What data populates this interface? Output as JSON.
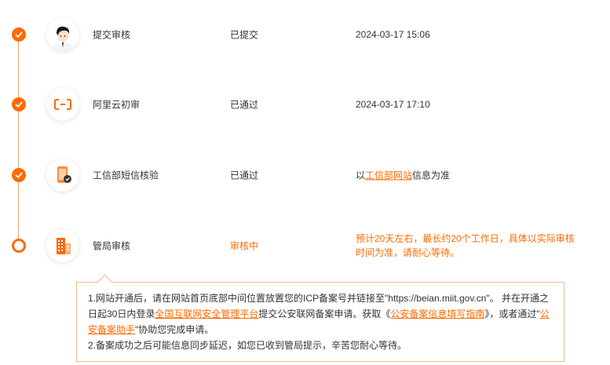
{
  "colors": {
    "accent": "#ff6a00",
    "border": "#f5b98f",
    "line": "#f0a070"
  },
  "steps": [
    {
      "name": "提交审核",
      "status": "已提交",
      "time": "2024-03-17 15:06",
      "icon": "person-avatar-icon",
      "state": "done"
    },
    {
      "name": "阿里云初审",
      "status": "已通过",
      "time": "2024-03-17 17:10",
      "icon": "aliyun-logo-icon",
      "state": "done"
    },
    {
      "name": "工信部短信核验",
      "status": "已通过",
      "note_prefix": "以",
      "note_link": "工信部网站",
      "note_suffix": "信息为准",
      "icon": "phone-check-icon",
      "state": "done"
    },
    {
      "name": "管局审核",
      "status": "审核中",
      "note": "预计20天左右，最长约20个工作日，具体以实际审核时间为准，请耐心等待。",
      "icon": "building-icon",
      "state": "pending"
    }
  ],
  "notice": {
    "line1_a": "1.网站开通后，请在网站首页底部中间位置放置您的ICP备案号并链接至\"https://beian.miit.gov.cn\"。 并在开通之日起30日内登录",
    "line1_link1": "全国互联网安全管理平台",
    "line1_b": "提交公安联网备案申请。获取《",
    "line1_link2": "公安备案信息填写指南",
    "line1_c": "》，或者通过\"",
    "line1_link3": "公安备案助手",
    "line1_d": "\"协助您完成申请。",
    "line2": "2.备案成功之后可能信息同步延迟，如您已收到管局提示，辛苦您耐心等待。"
  }
}
